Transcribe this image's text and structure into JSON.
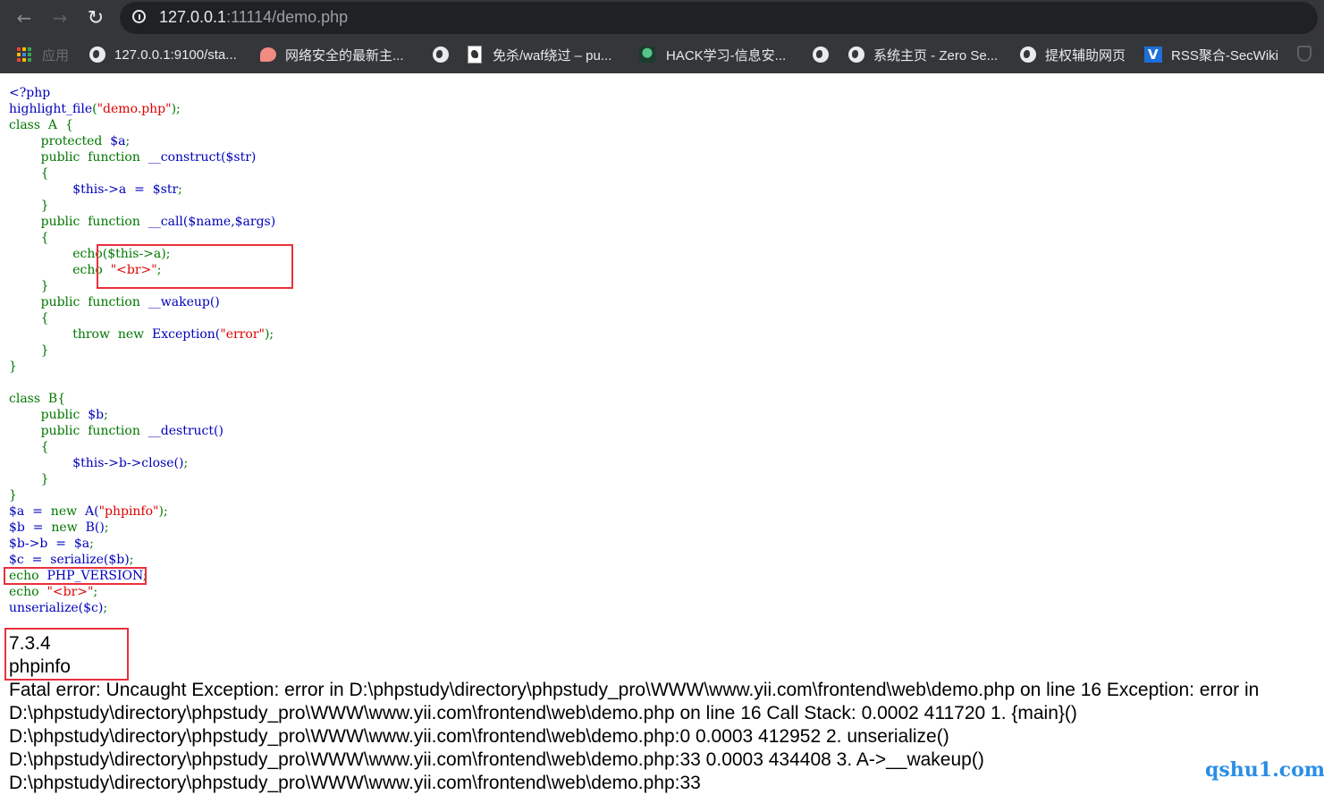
{
  "browser": {
    "url_host": "127.0.0.1",
    "url_rest": ":11114/demo.php",
    "nav_icons": [
      "back-arrow-icon",
      "forward-arrow-icon",
      "reload-icon",
      "info-icon"
    ],
    "bookmarks": [
      {
        "label": "应用",
        "icon": "apps-grid-icon"
      },
      {
        "label": "127.0.0.1:9100/sta...",
        "icon": "globe-icon"
      },
      {
        "label": "网络安全的最新主...",
        "icon": "chat-icon"
      },
      {
        "label": "",
        "icon": "globe-icon"
      },
      {
        "label": "免杀/waf绕过 – pu...",
        "icon": "document-icon"
      },
      {
        "label": "HACK学习-信息安...",
        "icon": "hack-icon"
      },
      {
        "label": "",
        "icon": "globe-icon"
      },
      {
        "label": "系统主页 - Zero Se...",
        "icon": "globe-icon"
      },
      {
        "label": "提权辅助网页",
        "icon": "globe-icon"
      },
      {
        "label": "RSS聚合-SecWiki",
        "icon": "rss-icon"
      }
    ]
  },
  "code": {
    "line01": "<?php",
    "line02_fn": "highlight_file",
    "line02_str": "\"demo.php\"",
    "line03": "class  A  {",
    "line04": "protected",
    "line04_var": "  $a",
    "line05": "public  function  ",
    "line05_name": "__construct($str)",
    "line06": "{",
    "line07": "$this->a  =  $str",
    "line08": "}",
    "line09_name": "__call($name,$args)",
    "line10": "{",
    "line11": "echo($this->a)",
    "line12_kw": "echo  ",
    "line12_str": "\"<br>\"",
    "line13": "}",
    "line14_name": "__wakeup()",
    "line15": "{",
    "line16_kw": "throw  new  ",
    "line16_cls": "Exception(",
    "line16_str": "\"error\"",
    "line17": "}",
    "line18": "}",
    "line20": "class  B{",
    "line21": "public  ",
    "line21_var": "$b",
    "line22_name": "__destruct()",
    "line23": "{",
    "line24": "$this->b->close()",
    "line25": "}",
    "line26": "}",
    "line27_a": "$a  =  ",
    "line27_b": "new  ",
    "line27_c": "A(",
    "line27_str": "\"phpinfo\"",
    "line28_a": "$b  =  ",
    "line28_c": "B()",
    "line29": "$b->b  =  $a",
    "line30_a": "$c  =  ",
    "line30_b": "serialize($b)",
    "line31_kw": "echo  ",
    "line31_const": "PHP_VERSION",
    "line32_kw": "echo  ",
    "line32_str": "\"<br>\"",
    "line33": "unserialize($c)"
  },
  "output": {
    "version": "7.3.4",
    "echo_value": "phpinfo",
    "fatal_1": "Fatal error: Uncaught Exception: error in D:\\phpstudy\\directory\\phpstudy_pro\\WWW\\www.yii.com\\frontend\\web\\demo.php on line 16 Exception: error in",
    "fatal_2": "D:\\phpstudy\\directory\\phpstudy_pro\\WWW\\www.yii.com\\frontend\\web\\demo.php on line 16 Call Stack: 0.0002 411720 1. {main}()",
    "fatal_3": "D:\\phpstudy\\directory\\phpstudy_pro\\WWW\\www.yii.com\\frontend\\web\\demo.php:0 0.0003 412952 2. unserialize()",
    "fatal_4": "D:\\phpstudy\\directory\\phpstudy_pro\\WWW\\www.yii.com\\frontend\\web\\demo.php:33 0.0003 434408 3. A->__wakeup()",
    "fatal_5": "D:\\phpstudy\\directory\\phpstudy_pro\\WWW\\www.yii.com\\frontend\\web\\demo.php:33"
  },
  "watermark": "qshu1.com",
  "colors": {
    "highlight_box": "#e8313c",
    "php_keyword": "#007700",
    "php_default": "#0000bb",
    "php_string": "#dd0000"
  }
}
